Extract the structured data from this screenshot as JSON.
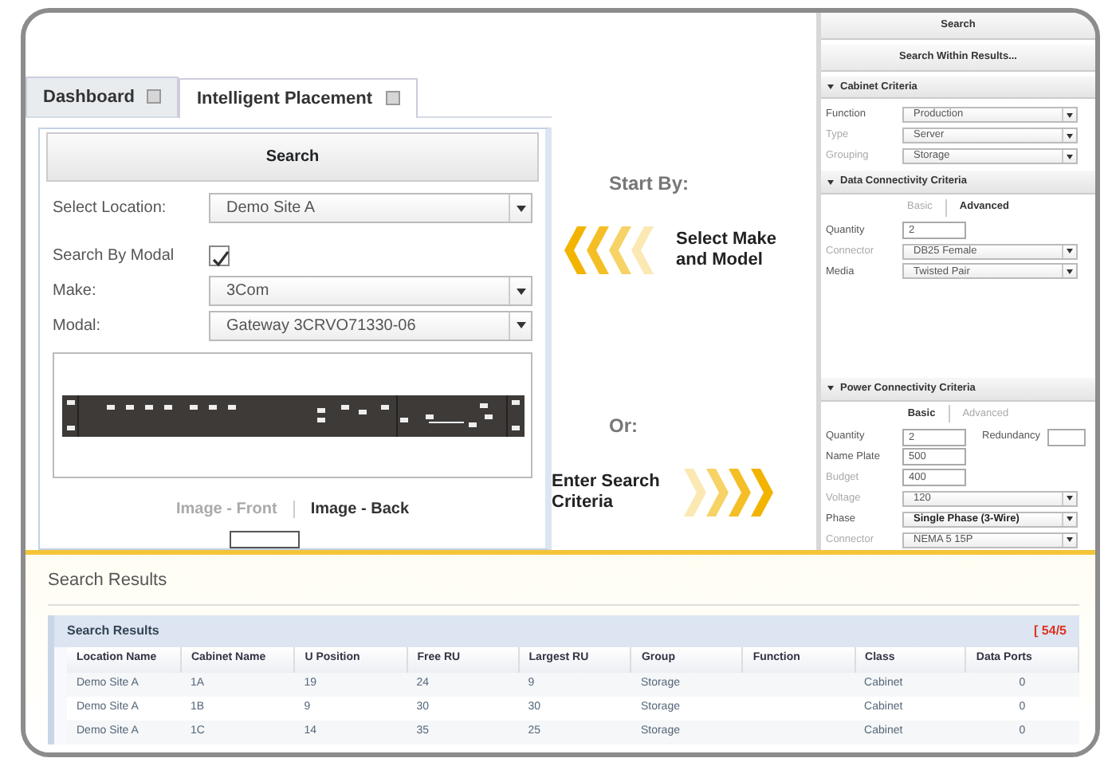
{
  "tabs": [
    {
      "label": "Dashboard",
      "selected": false
    },
    {
      "label": "Intelligent Placement",
      "selected": true
    }
  ],
  "search_panel": {
    "title": "Search",
    "fields": [
      {
        "kind": "select",
        "label": "Select Location:",
        "value": "Demo Site A"
      },
      {
        "kind": "checkbox",
        "label": "Search By Modal",
        "checked": true
      },
      {
        "kind": "select",
        "label": "Make:",
        "value": "3Com"
      },
      {
        "kind": "select",
        "label": "Modal:",
        "value": "Gateway 3CRVO71330-06"
      }
    ],
    "image_views": [
      {
        "label": "Image - Front",
        "selected": false
      },
      {
        "label": "Image - Back",
        "selected": true
      }
    ]
  },
  "callouts": [
    {
      "heading": "Start By:",
      "text": "Select Make and Model",
      "kind": "left"
    },
    {
      "heading": "Or:",
      "text": "Enter Search Criteria",
      "kind": "right"
    }
  ],
  "criteria_panel": {
    "title": "Search",
    "search_within": "Search Within Results...",
    "sections": [
      {
        "title": "Cabinet Criteria",
        "fields": [
          {
            "kind": "select",
            "label": "Function",
            "value": "Production",
            "disabled": false,
            "bold": false
          },
          {
            "kind": "select",
            "label": "Type",
            "value": "Server",
            "disabled": true,
            "bold": false
          },
          {
            "kind": "select",
            "label": "Grouping",
            "value": "Storage",
            "disabled": true,
            "bold": false
          }
        ]
      },
      {
        "title": "Data Connectivity Criteria",
        "subtabs": [
          {
            "label": "Basic",
            "selected": false
          },
          {
            "label": "Advanced",
            "selected": true
          }
        ],
        "fields": [
          {
            "kind": "input",
            "label": "Quantity",
            "value": "2",
            "disabled": false,
            "bold": false
          },
          {
            "kind": "select",
            "label": "Connector",
            "value": "DB25 Female",
            "disabled": true,
            "bold": false
          },
          {
            "kind": "select",
            "label": "Media",
            "value": "Twisted Pair",
            "disabled": false,
            "bold": false
          }
        ]
      },
      {
        "title": "Power Connectivity Criteria",
        "subtabs": [
          {
            "label": "Basic",
            "selected": true
          },
          {
            "label": "Advanced",
            "selected": false
          }
        ],
        "fields": [
          {
            "kind": "input",
            "label": "Quantity",
            "value": "2",
            "disabled": false,
            "bold": false,
            "side_label": "Redundancy"
          },
          {
            "kind": "input",
            "label": "Name Plate",
            "value": "500",
            "disabled": false,
            "bold": false
          },
          {
            "kind": "input",
            "label": "Budget",
            "value": "400",
            "disabled": true,
            "bold": false
          },
          {
            "kind": "select",
            "label": "Voltage",
            "value": "120",
            "disabled": true,
            "bold": false
          },
          {
            "kind": "select",
            "label": "Phase",
            "value": "Single Phase (3-Wire)",
            "disabled": false,
            "bold": true
          },
          {
            "kind": "select",
            "label": "Connector",
            "value": "NEMA 5 15P",
            "disabled": true,
            "bold": false
          }
        ]
      }
    ]
  },
  "results": {
    "heading": "Search Results",
    "grid_title": "Search Results",
    "count": "[ 54/5",
    "columns": [
      "Location Name",
      "Cabinet Name",
      "U Position",
      "Free RU",
      "Largest RU",
      "Group",
      "Function",
      "Class",
      "Data Ports"
    ],
    "rows": [
      [
        "Demo Site A",
        "1A",
        "19",
        "24",
        "9",
        "Storage",
        "",
        "Cabinet",
        "0"
      ],
      [
        "Demo Site A",
        "1B",
        "9",
        "30",
        "30",
        "Storage",
        "",
        "Cabinet",
        "0"
      ],
      [
        "Demo Site A",
        "1C",
        "14",
        "35",
        "25",
        "Storage",
        "",
        "Cabinet",
        "0"
      ]
    ]
  }
}
